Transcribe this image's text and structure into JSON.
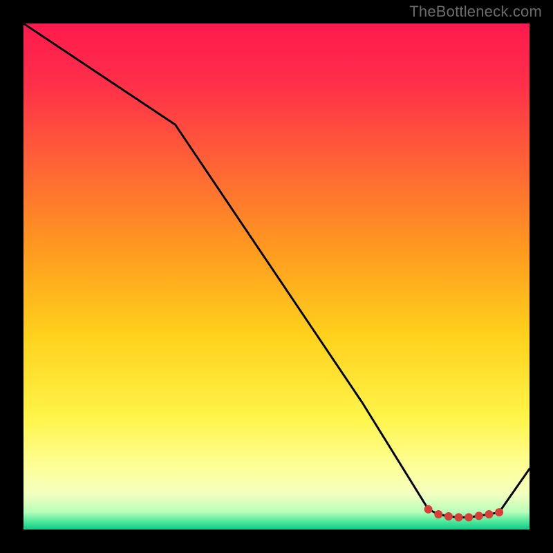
{
  "watermark": "TheBottleneck.com",
  "chart_data": {
    "type": "line",
    "title": "",
    "xlabel": "",
    "ylabel": "",
    "xlim": [
      0,
      100
    ],
    "ylim": [
      0,
      100
    ],
    "grid": false,
    "legend": false,
    "series": [
      {
        "name": "curve",
        "x": [
          0,
          15,
          30,
          67,
          80,
          82,
          84,
          86,
          88,
          90,
          92,
          94,
          100
        ],
        "values": [
          100,
          90,
          80,
          25,
          4,
          3,
          2.6,
          2.4,
          2.4,
          2.7,
          3,
          3.4,
          12
        ]
      }
    ],
    "markers": {
      "name": "cluster-red",
      "color": "#d64039",
      "x": [
        80,
        82,
        84,
        86,
        88,
        90,
        92,
        94
      ],
      "values": [
        4,
        3,
        2.6,
        2.4,
        2.4,
        2.7,
        3,
        3.4
      ]
    },
    "background_gradient": {
      "stops": [
        {
          "offset": 0.0,
          "color": "#ff1a4d"
        },
        {
          "offset": 0.12,
          "color": "#ff2f4a"
        },
        {
          "offset": 0.3,
          "color": "#ff6a33"
        },
        {
          "offset": 0.45,
          "color": "#ff9b1f"
        },
        {
          "offset": 0.62,
          "color": "#ffd21c"
        },
        {
          "offset": 0.78,
          "color": "#fff54a"
        },
        {
          "offset": 0.88,
          "color": "#fdff9a"
        },
        {
          "offset": 0.93,
          "color": "#f3ffbf"
        },
        {
          "offset": 0.965,
          "color": "#b9ffba"
        },
        {
          "offset": 0.985,
          "color": "#49e89a"
        },
        {
          "offset": 1.0,
          "color": "#14c88a"
        }
      ]
    }
  }
}
